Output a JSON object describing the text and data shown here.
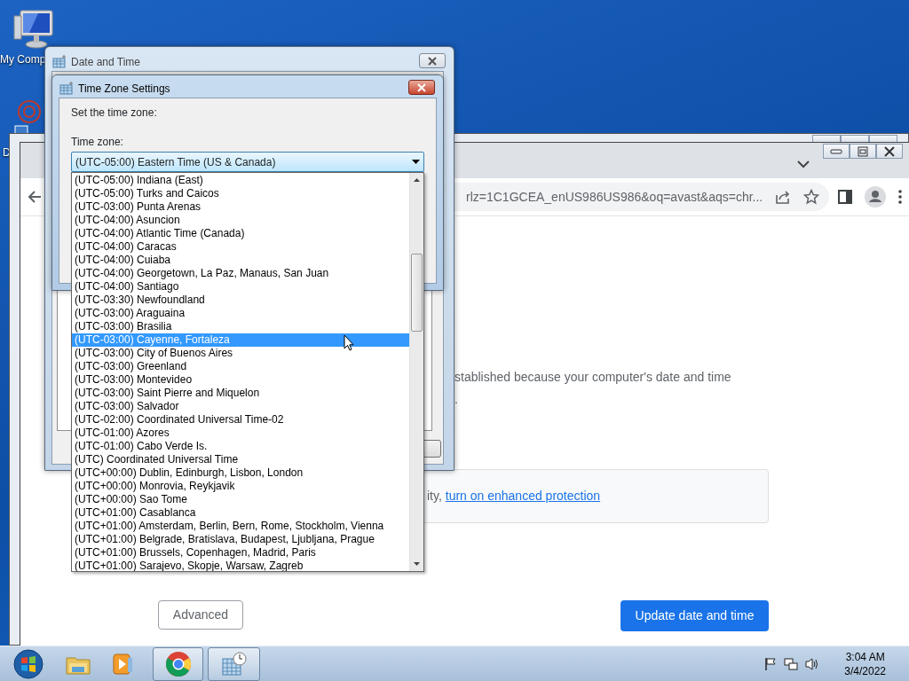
{
  "desktop_icons": [
    {
      "label": "My Comp",
      "kind": "computer"
    },
    {
      "label": "D",
      "kind": "program"
    }
  ],
  "browser": {
    "address": "rlz=1C1GCEA_enUS986US986&oq=avast&aqs=chr...",
    "message": "stablished because your computer's date and time",
    "message_line2": ".",
    "notice": {
      "text": "ity, ",
      "link": "turn on enhanced protection"
    },
    "buttons": [
      {
        "label": "Advanced",
        "kind": "secondary"
      },
      {
        "label": "Update date and time",
        "kind": "primary"
      }
    ]
  },
  "date_time_window": {
    "title": "Date and Time"
  },
  "time_zone_dialog": {
    "title": "Time Zone Settings",
    "prompt": "Set the time zone:",
    "field_label": "Time zone:",
    "value": "(UTC-05:00) Eastern Time (US & Canada)",
    "expanded": true,
    "options": [
      {
        "label": "(UTC-05:00) Indiana (East)",
        "selected": false
      },
      {
        "label": "(UTC-05:00) Turks and Caicos",
        "selected": false
      },
      {
        "label": "(UTC-03:00) Punta Arenas",
        "selected": false
      },
      {
        "label": "(UTC-04:00) Asuncion",
        "selected": false
      },
      {
        "label": "(UTC-04:00) Atlantic Time (Canada)",
        "selected": false
      },
      {
        "label": "(UTC-04:00) Caracas",
        "selected": false
      },
      {
        "label": "(UTC-04:00) Cuiaba",
        "selected": false
      },
      {
        "label": "(UTC-04:00) Georgetown, La Paz, Manaus, San Juan",
        "selected": false
      },
      {
        "label": "(UTC-04:00) Santiago",
        "selected": false
      },
      {
        "label": "(UTC-03:30) Newfoundland",
        "selected": false
      },
      {
        "label": "(UTC-03:00) Araguaina",
        "selected": false
      },
      {
        "label": "(UTC-03:00) Brasilia",
        "selected": false
      },
      {
        "label": "(UTC-03:00) Cayenne, Fortaleza",
        "selected": true
      },
      {
        "label": "(UTC-03:00) City of Buenos Aires",
        "selected": false
      },
      {
        "label": "(UTC-03:00) Greenland",
        "selected": false
      },
      {
        "label": "(UTC-03:00) Montevideo",
        "selected": false
      },
      {
        "label": "(UTC-03:00) Saint Pierre and Miquelon",
        "selected": false
      },
      {
        "label": "(UTC-03:00) Salvador",
        "selected": false
      },
      {
        "label": "(UTC-02:00) Coordinated Universal Time-02",
        "selected": false
      },
      {
        "label": "(UTC-01:00) Azores",
        "selected": false
      },
      {
        "label": "(UTC-01:00) Cabo Verde Is.",
        "selected": false
      },
      {
        "label": "(UTC) Coordinated Universal Time",
        "selected": false
      },
      {
        "label": "(UTC+00:00) Dublin, Edinburgh, Lisbon, London",
        "selected": false
      },
      {
        "label": "(UTC+00:00) Monrovia, Reykjavik",
        "selected": false
      },
      {
        "label": "(UTC+00:00) Sao Tome",
        "selected": false
      },
      {
        "label": "(UTC+01:00) Casablanca",
        "selected": false
      },
      {
        "label": "(UTC+01:00) Amsterdam, Berlin, Bern, Rome, Stockholm, Vienna",
        "selected": false
      },
      {
        "label": "(UTC+01:00) Belgrade, Bratislava, Budapest, Ljubljana, Prague",
        "selected": false
      },
      {
        "label": "(UTC+01:00) Brussels, Copenhagen, Madrid, Paris",
        "selected": false
      },
      {
        "label": "(UTC+01:00) Sarajevo, Skopje, Warsaw, Zagreb",
        "selected": false
      }
    ]
  },
  "taskbar": {
    "apps": [
      {
        "kind": "explorer",
        "running": false
      },
      {
        "kind": "media",
        "running": false
      },
      {
        "kind": "chrome",
        "running": true
      },
      {
        "kind": "datetime",
        "running": true
      }
    ],
    "clock": {
      "time": "3:04 AM",
      "date": "3/4/2022"
    }
  }
}
